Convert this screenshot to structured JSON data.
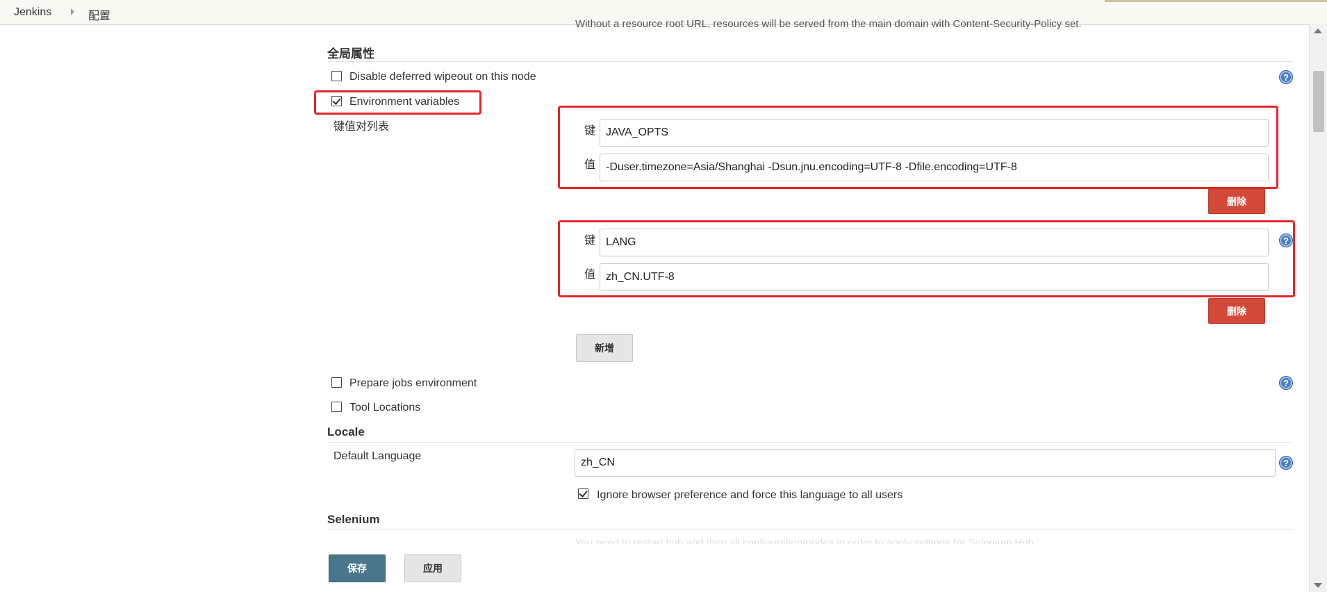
{
  "breadcrumb": {
    "home": "Jenkins",
    "current": "配置"
  },
  "top_note": "Without a resource root URL, resources will be served from the main domain with Content-Security-Policy set.",
  "global_properties": {
    "title": "全局属性",
    "disable_wipeout": {
      "label": "Disable deferred wipeout on this node",
      "checked": false
    },
    "env_vars": {
      "label": "Environment variables",
      "checked": true
    },
    "kv_list_label": "键值对列表",
    "key_label": "键",
    "value_label": "值",
    "entries": [
      {
        "key": "JAVA_OPTS",
        "value": "-Duser.timezone=Asia/Shanghai -Dsun.jnu.encoding=UTF-8 -Dfile.encoding=UTF-8",
        "delete_label": "删除"
      },
      {
        "key": "LANG",
        "value": "zh_CN.UTF-8",
        "delete_label": "删除"
      }
    ],
    "add_label": "新增",
    "prepare_jobs": {
      "label": "Prepare jobs environment",
      "checked": false
    },
    "tool_locations": {
      "label": "Tool Locations",
      "checked": false
    }
  },
  "locale": {
    "title": "Locale",
    "default_language_label": "Default Language",
    "default_language_value": "zh_CN",
    "ignore_browser": {
      "label": "Ignore browser preference and force this language to all users",
      "checked": true
    }
  },
  "selenium": {
    "title": "Selenium",
    "note": "You need to restart hub and then all configuration/nodes in order to apply settings for Selenium Hub"
  },
  "actions": {
    "save_label": "保存",
    "apply_label": "应用"
  },
  "icons": {
    "help": "help-icon",
    "check": "check-icon"
  },
  "colors": {
    "highlight": "#e5262a",
    "delete_button": "#d24939",
    "save_button": "#4b758b",
    "help_icon": "#4d7fc2"
  }
}
